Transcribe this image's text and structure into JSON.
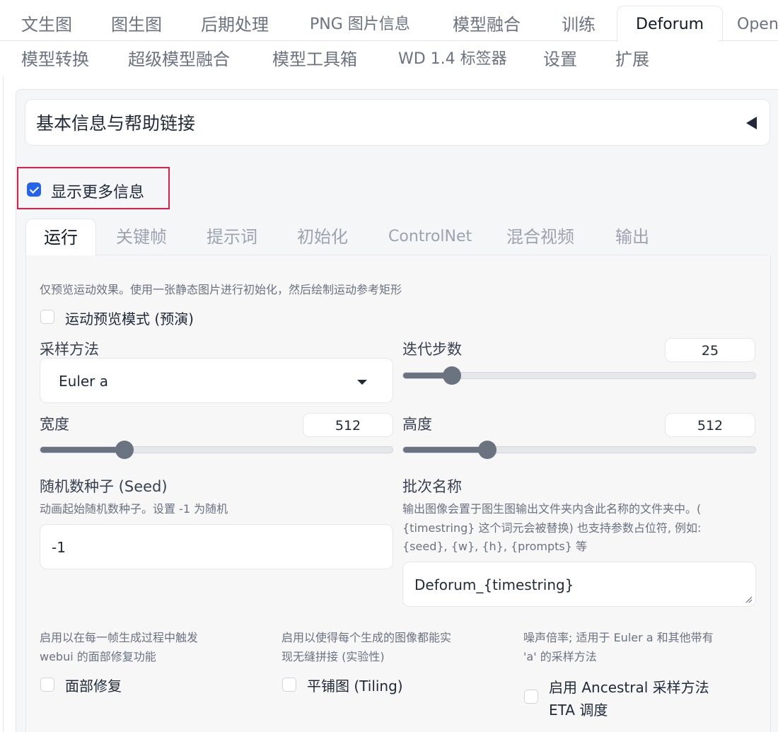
{
  "top_tabs": [
    "文生图",
    "图生图",
    "后期处理",
    "PNG 图片信息",
    "模型融合",
    "训练",
    "Deforum",
    "Open"
  ],
  "top_tabs_row2": [
    "模型转换",
    "超级模型融合",
    "模型工具箱",
    "WD 1.4 标签器",
    "设置",
    "扩展"
  ],
  "accordion": {
    "title": "基本信息与帮助链接"
  },
  "show_more": {
    "label": "显示更多信息",
    "checked": true
  },
  "inner_tabs": [
    "运行",
    "关键帧",
    "提示词",
    "初始化",
    "ControlNet",
    "混合视频",
    "输出"
  ],
  "run": {
    "preview_info": "仅预览运动效果。使用一张静态图片进行初始化，然后绘制运动参考矩形",
    "preview_label": "运动预览模式 (预演)",
    "sampler_label": "采样方法",
    "sampler_value": "Euler a",
    "steps_label": "迭代步数",
    "steps_value": "25",
    "steps_fraction": 0.14,
    "width_label": "宽度",
    "width_value": "512",
    "width_fraction": 0.24,
    "height_label": "高度",
    "height_value": "512",
    "height_fraction": 0.24,
    "seed_label": "随机数种子 (Seed)",
    "seed_info": "动画起始随机数种子。设置 -1 为随机",
    "seed_value": "-1",
    "batch_label": "批次名称",
    "batch_info_1": "输出图像会置于图生图输出文件夹内含此名称的文件夹中。(",
    "batch_info_2": "{timestring} 这个词元会被替换) 也支持参数占位符, 例如:",
    "batch_info_3": "{seed}, {w}, {h}, {prompts} 等",
    "batch_value": "Deforum_{timestring}",
    "face_info_1": "启用以在每一帧生成过程中触发",
    "face_info_2": "webui 的面部修复功能",
    "face_label": "面部修复",
    "tiling_info_1": "启用以使得每个生成的图像都能实",
    "tiling_info_2": "现无缝拼接 (实验性)",
    "tiling_label": "平铺图 (Tiling)",
    "eta_info_1": "噪声倍率; 适用于 Euler a 和其他带有",
    "eta_info_2": "'a' 的采样方法",
    "eta_label_1": "启用 Ancestral 采样方法",
    "eta_label_2": "ETA 调度"
  }
}
